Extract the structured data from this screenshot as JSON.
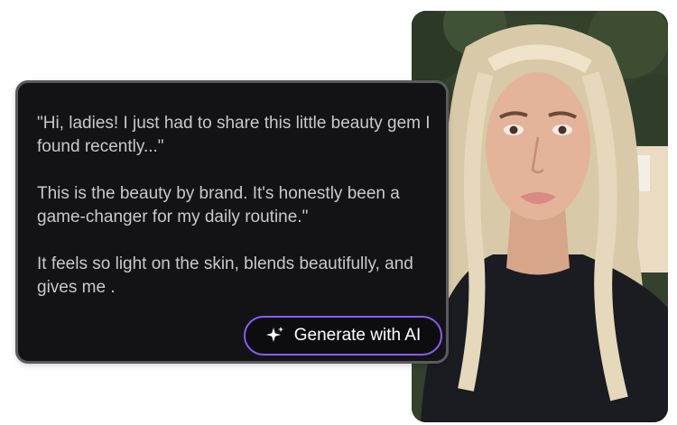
{
  "script_card": {
    "paragraphs": [
      "\"Hi, ladies! I just had to share this little beauty gem I found recently...\"",
      "This is the beauty by brand. It's honestly been a game-changer for my daily routine.\"",
      "It feels so light on the skin, blends beautifully, and gives me ."
    ],
    "generate_button": {
      "label": "Generate with AI",
      "icon": "sparkle-icon"
    }
  },
  "presenter_photo": {
    "icon": "presenter-video-frame"
  },
  "colors": {
    "card_background": "#131315",
    "card_border": "#5a5a5e",
    "button_border_accent": "#8b5cf6",
    "text": "#c9c9cc"
  }
}
